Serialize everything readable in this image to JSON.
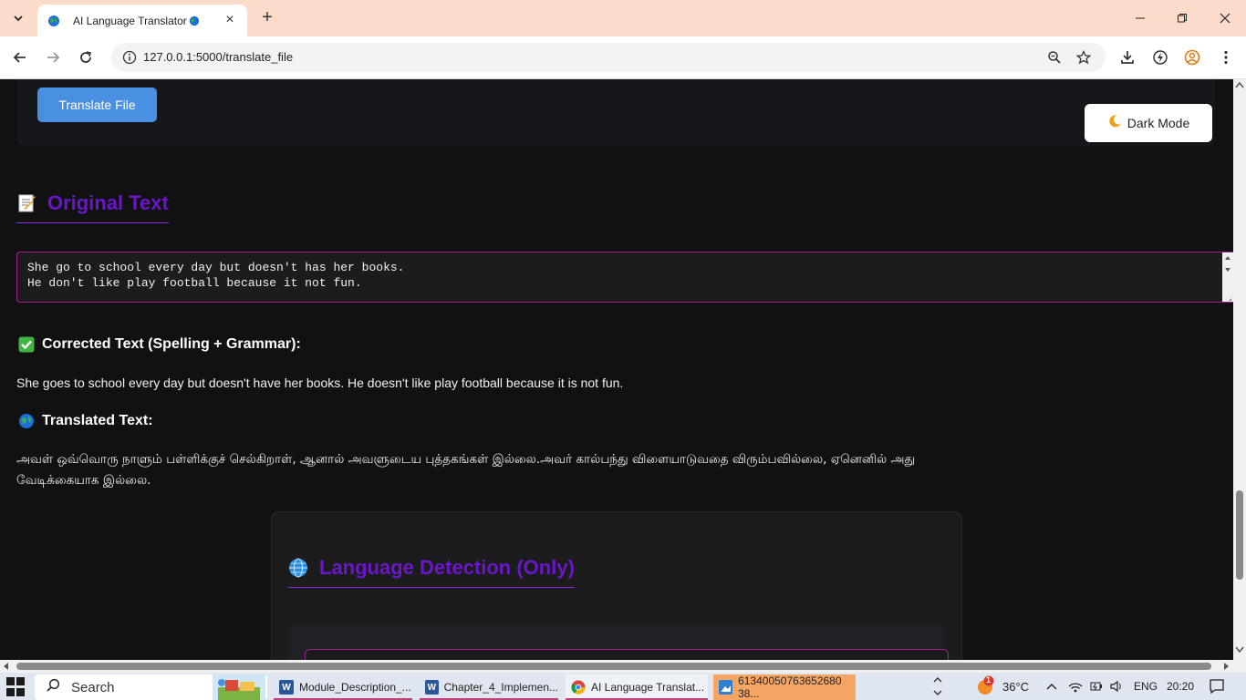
{
  "browser": {
    "tab_title": "AI Language Translator",
    "url": "127.0.0.1:5000/translate_file"
  },
  "page": {
    "translate_button": "Translate File",
    "dark_mode_button": "Dark Mode",
    "original_heading": "Original Text",
    "original_line1": "She go to school every day but doesn't has her books.",
    "original_line2": "He don't like play football because it not fun.",
    "corrected_heading": "Corrected Text (Spelling + Grammar):",
    "corrected_text": "She goes to school every day but doesn't have her books. He doesn't like play football because it is not fun.",
    "translated_heading": "Translated Text:",
    "translated_line1": "அவள் ஒவ்வொரு நாளும் பள்ளிக்குச் செல்கிறாள், ஆனால் அவளுடைய புத்தகங்கள் இல்லை.அவர் கால்பந்து விளையாடுவதை விரும்பவில்லை, ஏனெனில் அது",
    "translated_line2": "வேடிக்கையாக இல்லை.",
    "detection_heading": "Language Detection (Only)"
  },
  "taskbar": {
    "search_label": "Search",
    "items": [
      {
        "label": "Module_Description_..."
      },
      {
        "label": "Chapter_4_Implemen..."
      },
      {
        "label": "AI Language Translat..."
      },
      {
        "label": "61340050763652680​38..."
      }
    ],
    "weather": "36°C",
    "notification_count": "1",
    "language": "ENG",
    "time": "20:20"
  },
  "colors": {
    "accent_purple": "#6a16c9",
    "button_blue": "#4a90e2",
    "border_magenta": "#a0218c",
    "tabstrip": "#fbdccb"
  }
}
